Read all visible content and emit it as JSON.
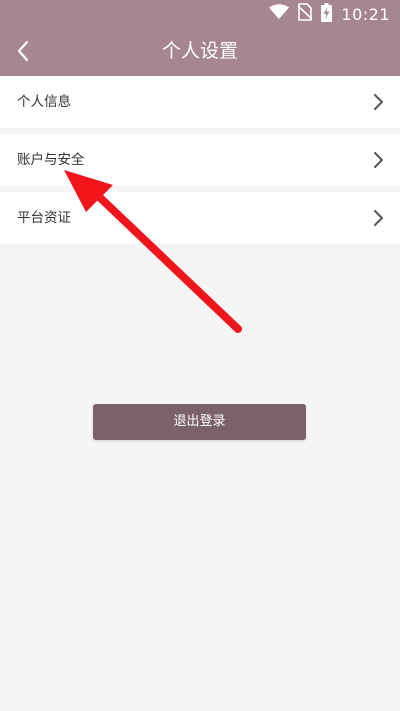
{
  "status_bar": {
    "time": "10:21",
    "icons": [
      "wifi-icon",
      "no-sim-icon",
      "battery-charging-icon"
    ]
  },
  "header": {
    "title": "个人设置",
    "back_icon": "chevron-left-icon"
  },
  "menu": {
    "items": [
      {
        "label": "个人信息",
        "icon": "chevron-right-icon"
      },
      {
        "label": "账户与安全",
        "icon": "chevron-right-icon"
      },
      {
        "label": "平台资证",
        "icon": "chevron-right-icon"
      }
    ]
  },
  "logout": {
    "label": "退出登录"
  },
  "colors": {
    "header_bg": "#a7878f",
    "page_bg": "#f5f5f5",
    "button_bg": "#7b6169",
    "annotation_arrow": "#f0141b"
  }
}
